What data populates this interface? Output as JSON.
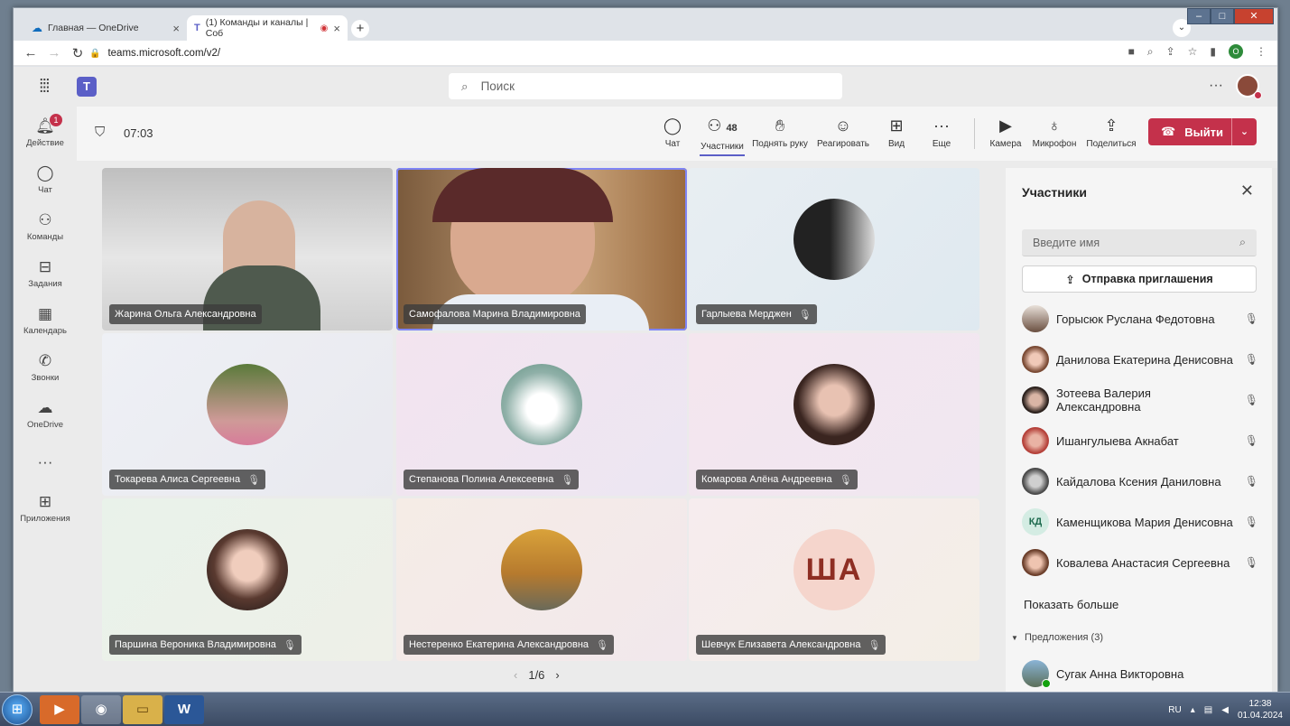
{
  "browser": {
    "tabs": [
      {
        "label": "Главная — OneDrive"
      },
      {
        "label": "(1) Команды и каналы | Соб"
      }
    ],
    "url": "teams.microsoft.com/v2/",
    "profile_initial": "O"
  },
  "teams": {
    "search_placeholder": "Поиск",
    "rail": [
      {
        "label": "Действие",
        "icon": "bell-icon",
        "badge": "1"
      },
      {
        "label": "Чат",
        "icon": "chat-icon"
      },
      {
        "label": "Команды",
        "icon": "teams-icon"
      },
      {
        "label": "Задания",
        "icon": "backpack-icon"
      },
      {
        "label": "Календарь",
        "icon": "calendar-icon"
      },
      {
        "label": "Звонки",
        "icon": "phone-icon"
      },
      {
        "label": "OneDrive",
        "icon": "cloud-icon"
      },
      {
        "label": "",
        "icon": "more-icon"
      },
      {
        "label": "Приложения",
        "icon": "plus-square-icon"
      }
    ]
  },
  "meeting": {
    "timer": "07:03",
    "participants_count": "48",
    "toolbar": {
      "chat": "Чат",
      "participants": "Участники",
      "raise_hand": "Поднять руку",
      "react": "Реагировать",
      "view": "Вид",
      "more": "Еще",
      "camera": "Камера",
      "mic": "Микрофон",
      "share": "Поделиться",
      "leave": "Выйти"
    },
    "tiles": [
      {
        "name": "Жарина Ольга Александровна",
        "muted": false,
        "speaking": false,
        "type": "video"
      },
      {
        "name": "Самофалова Марина Владимировна",
        "muted": false,
        "speaking": true,
        "type": "video"
      },
      {
        "name": "Гарлыева Мерджен",
        "muted": true,
        "type": "avatar"
      },
      {
        "name": "Токарева Алиса Сергеевна",
        "muted": true,
        "type": "avatar"
      },
      {
        "name": "Степанова Полина Алексеевна",
        "muted": true,
        "type": "avatar"
      },
      {
        "name": "Комарова Алёна Андреевна",
        "muted": true,
        "type": "avatar"
      },
      {
        "name": "Паршина Вероника Владимировна",
        "muted": true,
        "type": "avatar"
      },
      {
        "name": "Нестеренко Екатерина Александровна",
        "muted": true,
        "type": "avatar"
      },
      {
        "name": "Шевчук Елизавета Александровна",
        "muted": true,
        "type": "initials",
        "initials": "ША"
      }
    ],
    "pager": "1/6"
  },
  "panel": {
    "title": "Участники",
    "search_placeholder": "Введите имя",
    "invite_label": "Отправка приглашения",
    "people": [
      {
        "name": "Горысюк Руслана Федотовна"
      },
      {
        "name": "Данилова Екатерина Денисовна"
      },
      {
        "name": "Зотеева Валерия Александровна"
      },
      {
        "name": "Ишангулыева Акнабат"
      },
      {
        "name": "Кайдалова Ксения Даниловна"
      },
      {
        "name": "Каменщикова Мария Денисовна",
        "initials": "КД"
      },
      {
        "name": "Ковалева Анастасия Сергеевна"
      }
    ],
    "show_more": "Показать больше",
    "suggestions_label": "Предложения (3)",
    "suggested": [
      {
        "name": "Сугак Анна Викторовна"
      }
    ]
  },
  "taskbar": {
    "lang": "RU",
    "time": "12:38",
    "date": "01.04.2024"
  }
}
